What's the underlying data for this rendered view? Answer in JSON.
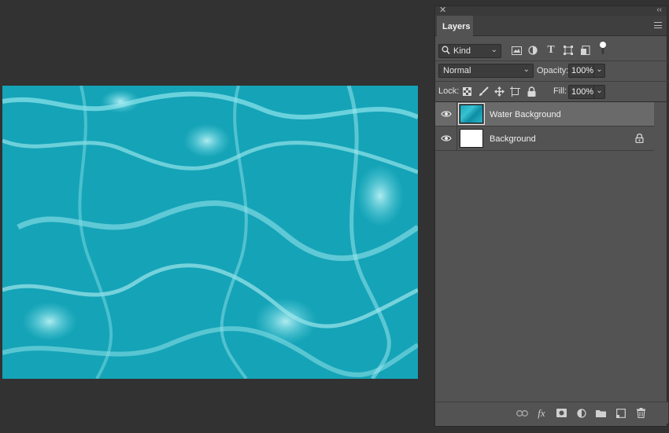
{
  "panel": {
    "tab_label": "Layers",
    "close_glyph": "✕",
    "collapse_glyph": "‹‹"
  },
  "filter": {
    "kind_label": "Kind",
    "icons": [
      "image-filter-icon",
      "adjustment-filter-icon",
      "type-filter-icon",
      "shape-filter-icon",
      "smart-object-filter-icon",
      "filter-toggle-icon"
    ]
  },
  "blend": {
    "mode": "Normal",
    "opacity_label": "Opacity:",
    "opacity_value": "100%"
  },
  "lock": {
    "label": "Lock:",
    "fill_label": "Fill:",
    "fill_value": "100%",
    "icons": [
      "lock-transparent-pixels-icon",
      "lock-image-pixels-icon",
      "lock-position-icon",
      "lock-artboard-icon",
      "lock-all-icon"
    ]
  },
  "layers": [
    {
      "name": "Water Background",
      "visible": true,
      "selected": true,
      "locked": false
    },
    {
      "name": "Background",
      "visible": true,
      "selected": false,
      "locked": true
    }
  ],
  "bottom_icons": [
    "link-layers-icon",
    "layer-style-icon",
    "add-mask-icon",
    "adjustment-layer-icon",
    "new-group-icon",
    "new-layer-icon",
    "delete-layer-icon"
  ],
  "colors": {
    "workspace": "#323232",
    "panel": "#535353",
    "selected_row": "#6a6a6a",
    "water": "#1aa6bc"
  }
}
